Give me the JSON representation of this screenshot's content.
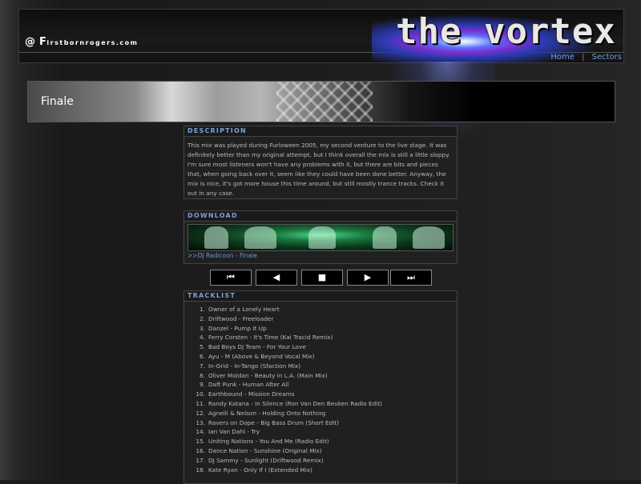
{
  "header": {
    "at_symbol": "@",
    "site_initial": "F",
    "site_rest": "irstbornrogers.com",
    "logo_text": "the vortex",
    "nav": [
      "Home",
      "|",
      "Sectors"
    ]
  },
  "banner": {
    "title": "Finale"
  },
  "description": {
    "heading": "DESCRIPTION",
    "text": "This mix was played during Furloween 2005, my second venture to the live stage. It was definitely better than my original attempt, but I think overall the mix is still a little sloppy. I'm sure most listeners won't have any problems with it, but there are bits and pieces that, when going back over it, seem like they could have been done better. Anyway, the mix is nice, it's got more house this time around, but still mostly trance tracks. Check it out in any case."
  },
  "download": {
    "heading": "DOWNLOAD",
    "link": ">>DJ Radicoon - Finale"
  },
  "controls": {
    "prev": "⏮",
    "back": "◀",
    "stop": "■",
    "play": "▶",
    "next": "⏭"
  },
  "tracklist": {
    "heading": "TRACKLIST",
    "numbers": [
      "1.",
      "2.",
      "3.",
      "4.",
      "5.",
      "6.",
      "7.",
      "8.",
      "9.",
      "10.",
      "11.",
      "12.",
      "13.",
      "14.",
      "15.",
      "16.",
      "17.",
      "18."
    ],
    "tracks": [
      "Owner of a Lonely Heart",
      "Driftwood - Freeloader",
      "Danzel - Pump It Up",
      "Ferry Corsten - It's Time (Kai Tracid Remix)",
      "Bad Boys DJ Team - For Your Love",
      "Ayu - M (Above & Beyond Vocal Mix)",
      "In-Grid - In-Tango (Sfaction Mix)",
      "Oliver Moldan - Beauty in L.A. (Main Mix)",
      "Daft Punk - Human After All",
      "Earthbound - Mission Dreams",
      "Randy Katana - In Silence (Ron Van Den Beuken Radio Edit)",
      "Agnelli & Nelson - Holding Onto Nothing",
      "Ravers on Dope - Big Bass Drum (Short Edit)",
      "Ian Van Dahl - Try",
      "Uniting Nations - You And Me (Radio Edit)",
      "Dance Nation - Sunshine (Original Mix)",
      "DJ Sammy - Sunlight (Driftwood Remix)",
      "Kate Ryan - Only If I (Extended Mix)"
    ]
  },
  "colors": {
    "accent": "#7aa0d8",
    "link": "#6aa0dc",
    "background": "#1c1c1c"
  }
}
